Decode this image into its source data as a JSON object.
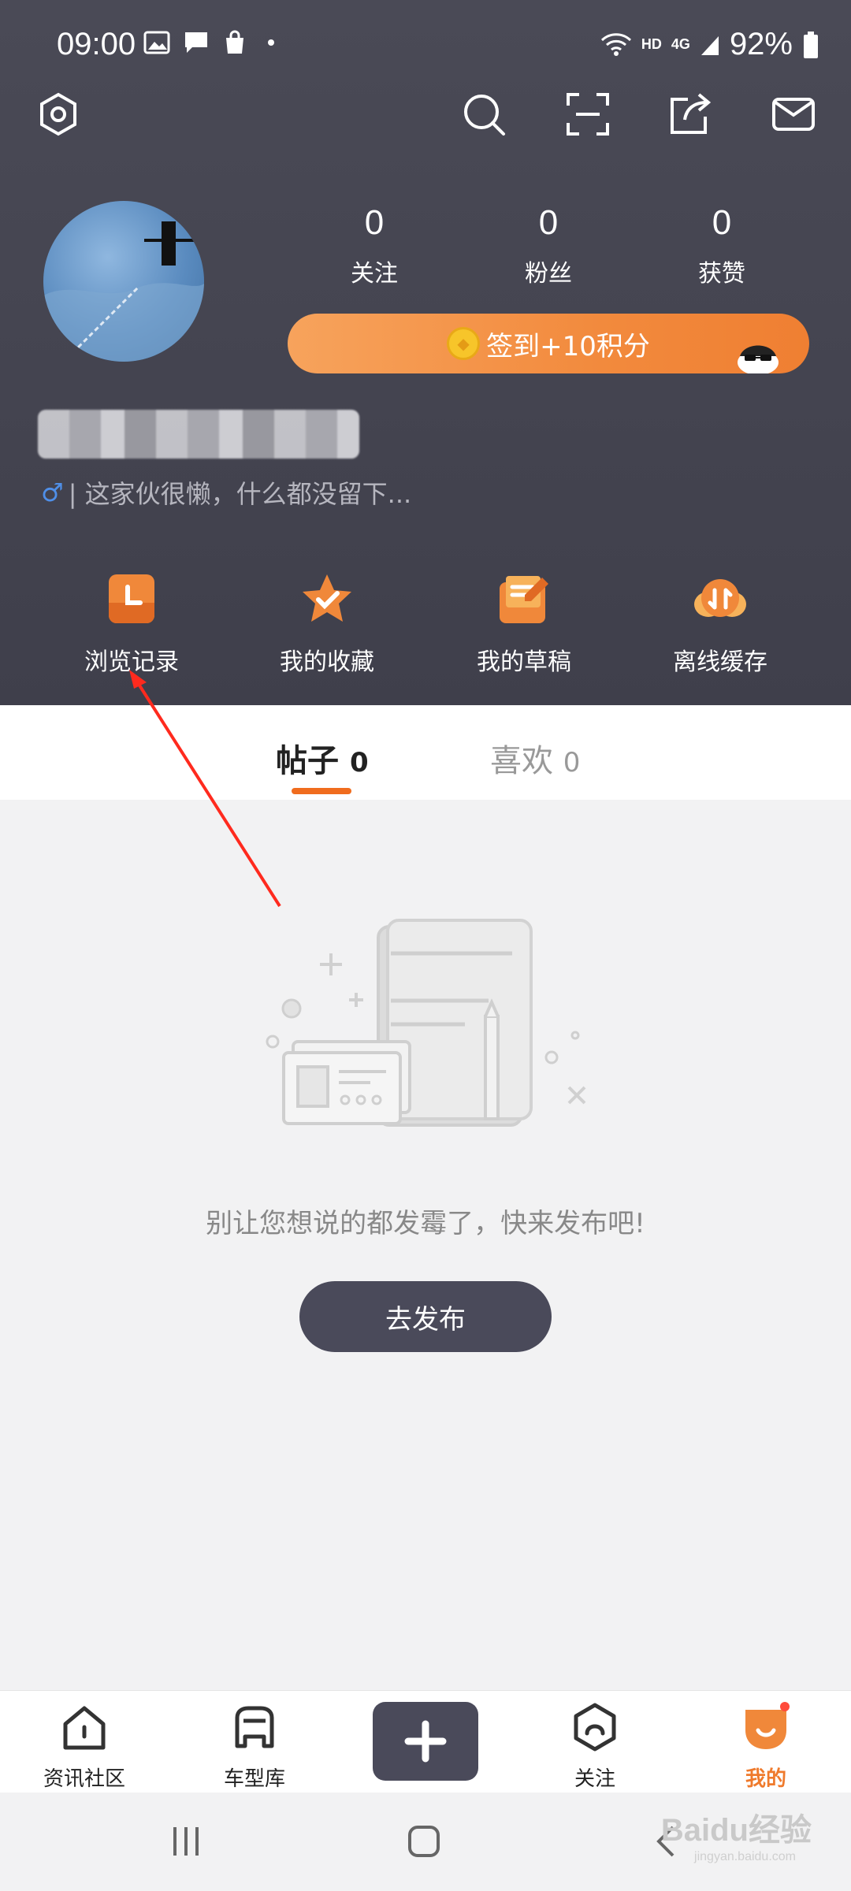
{
  "status_bar": {
    "time": "09:00",
    "network": "HD",
    "signal": "4G",
    "battery": "92%"
  },
  "stats": [
    {
      "value": "0",
      "label": "关注"
    },
    {
      "value": "0",
      "label": "粉丝"
    },
    {
      "value": "0",
      "label": "获赞"
    }
  ],
  "checkin": {
    "label": "签到+10积分"
  },
  "profile": {
    "gender_icon": "male-icon",
    "bio": "| 这家伙很懒，什么都没留下..."
  },
  "quick_actions": [
    {
      "label": "浏览记录",
      "icon": "history-icon"
    },
    {
      "label": "我的收藏",
      "icon": "favorites-icon"
    },
    {
      "label": "我的草稿",
      "icon": "drafts-icon"
    },
    {
      "label": "离线缓存",
      "icon": "offline-cache-icon"
    }
  ],
  "tabs": {
    "posts": {
      "label": "帖子",
      "count": "0"
    },
    "likes": {
      "label": "喜欢",
      "count": "0"
    }
  },
  "empty_state": {
    "message": "别让您想说的都发霉了，快来发布吧!",
    "button": "去发布"
  },
  "bottom_nav": [
    {
      "label": "资讯社区",
      "icon": "home-icon"
    },
    {
      "label": "车型库",
      "icon": "car-icon"
    },
    {
      "label": "",
      "icon": "plus-icon"
    },
    {
      "label": "关注",
      "icon": "follow-icon"
    },
    {
      "label": "我的",
      "icon": "me-icon"
    }
  ],
  "watermark": {
    "text": "Baidu经验",
    "sub": "jingyan.baidu.com"
  },
  "colors": {
    "header_bg": "#45454f",
    "accent": "#f06c1e",
    "button_dark": "#4a4a5a"
  }
}
